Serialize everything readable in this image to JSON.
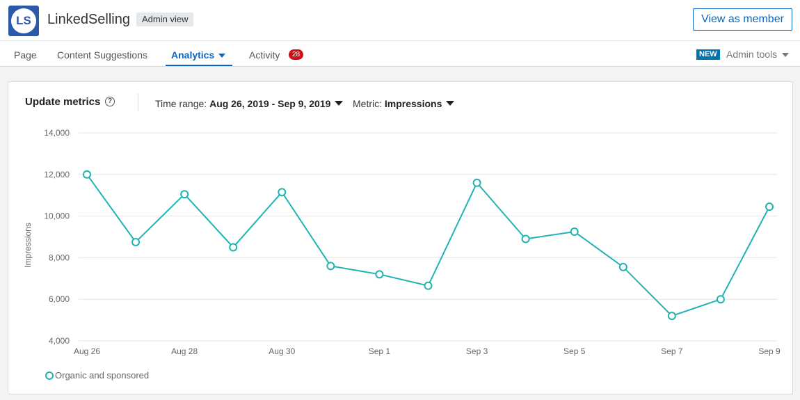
{
  "header": {
    "logo_text": "LS",
    "company_name": "LinkedSelling",
    "admin_badge": "Admin view",
    "view_as_member": "View as member"
  },
  "nav": {
    "page": "Page",
    "content_suggestions": "Content Suggestions",
    "analytics": "Analytics",
    "activity": "Activity",
    "activity_count": "28",
    "new_badge": "NEW",
    "admin_tools": "Admin tools"
  },
  "card": {
    "title": "Update metrics",
    "help_icon": "?",
    "time_range_label": "Time range:",
    "time_range_value": "Aug 26, 2019 - Sep 9, 2019",
    "metric_label": "Metric:",
    "metric_value": "Impressions"
  },
  "colors": {
    "accent": "#0a66c2",
    "series": "#1fb3b1",
    "badge_red": "#cc1016"
  },
  "chart_data": {
    "type": "line",
    "ylabel": "Impressions",
    "ylim": [
      4000,
      14000
    ],
    "yticks": [
      "4,000",
      "6,000",
      "8,000",
      "10,000",
      "12,000",
      "14,000"
    ],
    "ytick_values": [
      4000,
      6000,
      8000,
      10000,
      12000,
      14000
    ],
    "x": [
      "Aug 26",
      "Aug 27",
      "Aug 28",
      "Aug 29",
      "Aug 30",
      "Aug 31",
      "Sep 1",
      "Sep 2",
      "Sep 3",
      "Sep 4",
      "Sep 5",
      "Sep 6",
      "Sep 7",
      "Sep 8",
      "Sep 9"
    ],
    "xtick_labels": [
      "Aug 26",
      "Aug 28",
      "Aug 30",
      "Sep 1",
      "Sep 3",
      "Sep 5",
      "Sep 7",
      "Sep 9"
    ],
    "series": [
      {
        "name": "Organic and sponsored",
        "values": [
          12000,
          8750,
          11050,
          8500,
          11150,
          7600,
          7200,
          6650,
          11600,
          8900,
          9250,
          7550,
          5200,
          6000,
          10450
        ]
      }
    ],
    "grid": true,
    "legend": "bottom-left"
  }
}
